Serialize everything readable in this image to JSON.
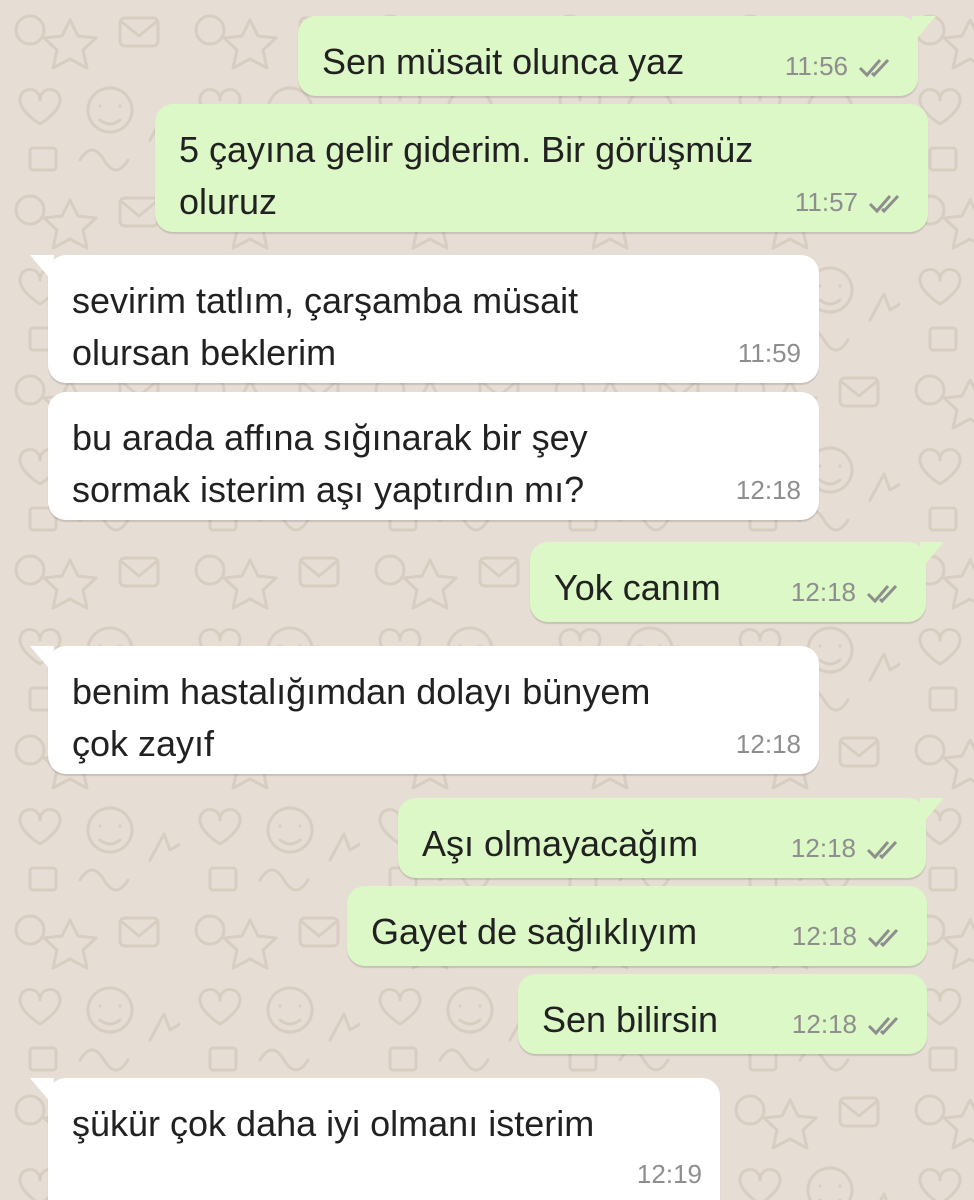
{
  "colors": {
    "background": "#e6ddd4",
    "outgoing_bubble": "#dcf8c6",
    "incoming_bubble": "#ffffff",
    "text": "#212121",
    "timestamp": "#8e8e8e"
  },
  "messages": [
    {
      "direction": "outgoing",
      "text": "Sen müsait olunca yaz",
      "time": "11:56",
      "status": "double-check-icon"
    },
    {
      "direction": "outgoing",
      "text": "5 çayına gelir giderim. Bir görüşmüz\noluruz",
      "time": "11:57",
      "status": "double-check-icon"
    },
    {
      "direction": "incoming",
      "text": "sevirim tatlım, çarşamba müsait\nolursan beklerim",
      "time": "11:59"
    },
    {
      "direction": "incoming",
      "text": "bu arada affına sığınarak bir şey\nsormak isterim aşı yaptırdın mı?",
      "time": "12:18"
    },
    {
      "direction": "outgoing",
      "text": "Yok canım",
      "time": "12:18",
      "status": "double-check-icon"
    },
    {
      "direction": "incoming",
      "text": "benim hastalığımdan dolayı bünyem\nçok zayıf",
      "time": "12:18"
    },
    {
      "direction": "outgoing",
      "text": "Aşı olmayacağım",
      "time": "12:18",
      "status": "double-check-icon"
    },
    {
      "direction": "outgoing",
      "text": "Gayet de sağlıklıyım",
      "time": "12:18",
      "status": "double-check-icon"
    },
    {
      "direction": "outgoing",
      "text": "Sen bilirsin",
      "time": "12:18",
      "status": "double-check-icon"
    },
    {
      "direction": "incoming",
      "text": "şükür çok daha iyi olmanı isterim",
      "time": "12:19"
    }
  ]
}
